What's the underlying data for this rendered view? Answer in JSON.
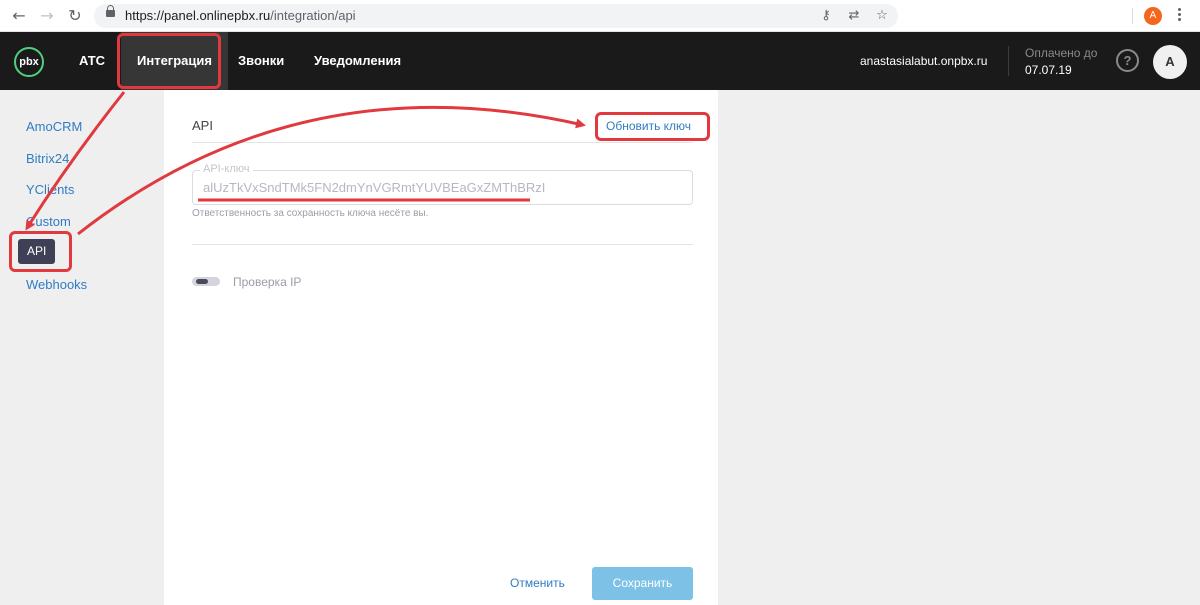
{
  "browser": {
    "url_main": "https://panel.onlinepbx.ru",
    "url_path": "/integration/api",
    "profile_initial": "A"
  },
  "header": {
    "logo_text": "pbx",
    "menu": [
      "АТС",
      "Интеграция",
      "Звонки",
      "Уведомления"
    ],
    "domain": "anastasialabut.onpbx.ru",
    "paid_label": "Оплачено до",
    "paid_date": "07.07.19",
    "help": "?",
    "avatar": "A"
  },
  "sidebar": {
    "items": [
      "AmoCRM",
      "Bitrix24",
      "YClients",
      "Custom",
      "API",
      "Webhooks"
    ]
  },
  "main": {
    "title": "API",
    "refresh_link": "Обновить ключ",
    "key_label": "API-ключ",
    "key_value": "alUzTkVxSndTMk5FN2dmYnVGRmtYUVBEaGxZMThBRzI",
    "hint": "Ответственность за сохранность ключа несёте вы.",
    "ip_check_label": "Проверка IP",
    "ip_check_enabled": false,
    "cancel_label": "Отменить",
    "save_label": "Сохранить"
  },
  "colors": {
    "header_bg": "#1a1a1a",
    "accent_link": "#2f7cc4",
    "annotation": "#e0393e",
    "logo_ring": "#4fd07f",
    "save_button": "#7dc2e6"
  }
}
